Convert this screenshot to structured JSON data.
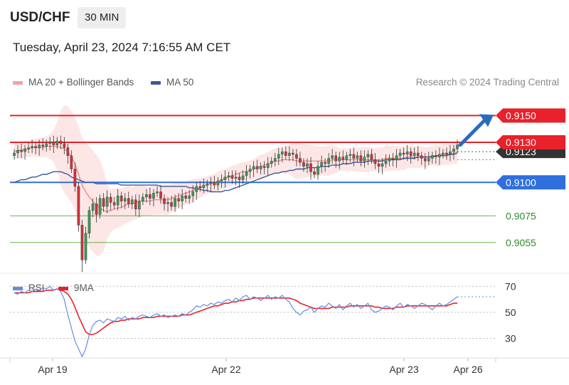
{
  "header": {
    "pair": "USD/CHF",
    "timeframe": "30 MIN"
  },
  "timestamp": "Tuesday, April 23, 2024 7:16:55 AM CET",
  "legend": {
    "ma20_bb": "MA 20 + Bollinger Bands",
    "ma50": "MA 50"
  },
  "copyright": "Research © 2024 Trading Central",
  "rsi_legend": {
    "rsi": "RSI",
    "ma9": "9MA"
  },
  "colors": {
    "resistance": "#e8212a",
    "pivot": "#2f6fde",
    "support": "#6ab04c",
    "bb_fill": "#fde2e2",
    "ma20": "#f08a8a",
    "ma50": "#3b5998",
    "bull": "#3a9a57",
    "bear": "#d2323a",
    "rsi": "#5f8fe0",
    "rsi_ma": "#e8212a",
    "arrow": "#2b6bbf"
  },
  "chart_data": [
    {
      "type": "candlestick",
      "title": "USD/CHF 30 MIN",
      "ylim": [
        0.9032,
        0.9163
      ],
      "x_ticks": [
        "Apr 19",
        "Apr 22",
        "Apr 23",
        "Apr 26"
      ],
      "levels": [
        {
          "value": 0.915,
          "label": "0.9150",
          "kind": "resistance"
        },
        {
          "value": 0.913,
          "label": "0.9130",
          "kind": "resistance"
        },
        {
          "value": 0.91,
          "label": "0.9100",
          "kind": "pivot"
        },
        {
          "value": 0.9075,
          "label": "0.9075",
          "kind": "support"
        },
        {
          "value": 0.9055,
          "label": "0.9055",
          "kind": "support"
        }
      ],
      "current_price": {
        "value": 0.9123,
        "label": "0.9123"
      },
      "projection": {
        "from": 0.9128,
        "to": 0.915,
        "direction": "up"
      },
      "closes": [
        0.9122,
        0.9124,
        0.9123,
        0.9125,
        0.9126,
        0.9127,
        0.9126,
        0.9128,
        0.9127,
        0.9129,
        0.913,
        0.9128,
        0.9131,
        0.9129,
        0.9126,
        0.912,
        0.911,
        0.9097,
        0.9068,
        0.9042,
        0.9062,
        0.9079,
        0.9084,
        0.9076,
        0.9088,
        0.9082,
        0.9089,
        0.9085,
        0.9083,
        0.909,
        0.9086,
        0.9088,
        0.9084,
        0.9087,
        0.908,
        0.9086,
        0.9089,
        0.9091,
        0.9088,
        0.9092,
        0.9093,
        0.9088,
        0.9084,
        0.9085,
        0.9082,
        0.9088,
        0.9086,
        0.909,
        0.9088,
        0.909,
        0.9093,
        0.9097,
        0.9096,
        0.9098,
        0.9099,
        0.91,
        0.9098,
        0.9101,
        0.9102,
        0.9104,
        0.9105,
        0.9103,
        0.9104,
        0.9102,
        0.9105,
        0.9108,
        0.911,
        0.9112,
        0.911,
        0.9112,
        0.9111,
        0.9114,
        0.9116,
        0.9118,
        0.9121,
        0.9123,
        0.912,
        0.9122,
        0.9121,
        0.9118,
        0.9115,
        0.9112,
        0.9114,
        0.9108,
        0.9106,
        0.9112,
        0.9115,
        0.9114,
        0.9118,
        0.912,
        0.9116,
        0.9119,
        0.9117,
        0.912,
        0.9121,
        0.9118,
        0.912,
        0.9116,
        0.9119,
        0.9121,
        0.9117,
        0.9114,
        0.9112,
        0.9114,
        0.9116,
        0.9118,
        0.9117,
        0.912,
        0.9122,
        0.9121,
        0.9123,
        0.912,
        0.9122,
        0.912,
        0.9118,
        0.9116,
        0.9118,
        0.912,
        0.9119,
        0.9121,
        0.9122,
        0.9121,
        0.9123,
        0.9125,
        0.9128
      ],
      "ma20": [
        0.9123,
        0.9124,
        0.9124,
        0.9125,
        0.9125,
        0.9126,
        0.9126,
        0.9126,
        0.9126,
        0.9127,
        0.9127,
        0.9127,
        0.9127,
        0.9126,
        0.9125,
        0.9123,
        0.9119,
        0.9114,
        0.9106,
        0.9098,
        0.9093,
        0.9089,
        0.9086,
        0.9083,
        0.9081,
        0.9079,
        0.9078,
        0.9079,
        0.908,
        0.9081,
        0.9081,
        0.9083,
        0.9084,
        0.9084,
        0.9085,
        0.9086,
        0.9086,
        0.9086,
        0.9086,
        0.9087,
        0.9087,
        0.9087,
        0.9087,
        0.9087,
        0.9088,
        0.9089,
        0.909,
        0.9091,
        0.9092,
        0.9093,
        0.9094,
        0.9095,
        0.9096,
        0.9097,
        0.9098,
        0.9099,
        0.91,
        0.9101,
        0.9102,
        0.9103,
        0.9104,
        0.9105,
        0.9106,
        0.9107,
        0.9108,
        0.9108,
        0.9109,
        0.911,
        0.9111,
        0.9112,
        0.9113,
        0.9114,
        0.9115,
        0.9116,
        0.9116,
        0.9117,
        0.9117,
        0.9117,
        0.9117,
        0.9116,
        0.9116,
        0.9116,
        0.9116,
        0.9116,
        0.9116,
        0.9116,
        0.9116,
        0.9116,
        0.9116,
        0.9117,
        0.9117,
        0.9117,
        0.9117,
        0.9117,
        0.9117,
        0.9117,
        0.9117,
        0.9117,
        0.9117,
        0.9117,
        0.9117,
        0.9117,
        0.9117,
        0.9117,
        0.9118,
        0.9118,
        0.9118,
        0.9118,
        0.9118,
        0.9118,
        0.9119,
        0.9119,
        0.9119,
        0.9119,
        0.9119,
        0.9119,
        0.9119,
        0.912,
        0.912,
        0.912,
        0.9121,
        0.9121,
        0.9121,
        0.9122,
        0.9122
      ],
      "ma50": [
        0.91,
        0.9101,
        0.9102,
        0.9102,
        0.9103,
        0.9104,
        0.9104,
        0.9105,
        0.9106,
        0.9106,
        0.9107,
        0.9108,
        0.9108,
        0.9108,
        0.9107,
        0.9106,
        0.9104,
        0.9103,
        0.9102,
        0.9101,
        0.91,
        0.91,
        0.91,
        0.9099,
        0.9099,
        0.9099,
        0.9099,
        0.9099,
        0.9099,
        0.9099,
        0.9098,
        0.9098,
        0.9098,
        0.9098,
        0.9098,
        0.9098,
        0.9098,
        0.9098,
        0.9098,
        0.9098,
        0.9098,
        0.9097,
        0.9097,
        0.9097,
        0.9097,
        0.9097,
        0.9097,
        0.9097,
        0.9097,
        0.9096,
        0.9096,
        0.9095,
        0.9095,
        0.9094,
        0.9094,
        0.9093,
        0.9093,
        0.9093,
        0.9093,
        0.9094,
        0.9094,
        0.9095,
        0.9096,
        0.9097,
        0.9098,
        0.9099,
        0.91,
        0.9101,
        0.9102,
        0.9103,
        0.9104,
        0.9105,
        0.9106,
        0.9107,
        0.9107,
        0.9108,
        0.9108,
        0.9109,
        0.9109,
        0.911,
        0.911,
        0.911,
        0.9111,
        0.9111,
        0.9111,
        0.9111,
        0.9112,
        0.9112,
        0.9112,
        0.9113,
        0.9113,
        0.9113,
        0.9114,
        0.9114,
        0.9114,
        0.9115,
        0.9115,
        0.9115,
        0.9115,
        0.9116,
        0.9116,
        0.9116,
        0.9116,
        0.9116,
        0.9117,
        0.9117,
        0.9117,
        0.9117,
        0.9117,
        0.9118,
        0.9118,
        0.9118,
        0.9118,
        0.9119,
        0.9119,
        0.9119,
        0.9119,
        0.9119,
        0.912,
        0.912,
        0.912,
        0.912,
        0.9121,
        0.9121,
        0.9122
      ]
    },
    {
      "type": "line",
      "title": "RSI",
      "ylim": [
        15,
        80
      ],
      "y_ticks": [
        70,
        50,
        30
      ],
      "series": [
        {
          "name": "RSI",
          "values": [
            65,
            64,
            66,
            65,
            67,
            66,
            68,
            67,
            69,
            68,
            70,
            67,
            68,
            66,
            60,
            48,
            38,
            28,
            22,
            16,
            22,
            33,
            40,
            43,
            44,
            42,
            45,
            44,
            43,
            46,
            45,
            47,
            44,
            46,
            45,
            47,
            48,
            47,
            46,
            48,
            49,
            47,
            48,
            46,
            47,
            48,
            47,
            49,
            48,
            50,
            52,
            55,
            54,
            56,
            55,
            57,
            56,
            58,
            57,
            59,
            60,
            58,
            61,
            59,
            62,
            63,
            60,
            62,
            61,
            59,
            61,
            63,
            60,
            62,
            61,
            63,
            60,
            58,
            53,
            50,
            48,
            51,
            52,
            54,
            50,
            53,
            55,
            54,
            57,
            55,
            53,
            56,
            52,
            55,
            57,
            54,
            56,
            53,
            55,
            57,
            52,
            50,
            51,
            53,
            55,
            54,
            52,
            55,
            57,
            54,
            56,
            55,
            53,
            55,
            57,
            56,
            54,
            52,
            55,
            57,
            55,
            56,
            58,
            60,
            62
          ]
        },
        {
          "name": "9MA",
          "values": [
            65,
            65,
            65,
            65,
            65,
            66,
            66,
            66,
            66,
            67,
            67,
            67,
            68,
            67,
            66,
            64,
            60,
            54,
            47,
            41,
            35,
            33,
            33,
            34,
            36,
            38,
            40,
            42,
            43,
            43,
            44,
            44,
            45,
            45,
            45,
            45,
            46,
            46,
            46,
            46,
            47,
            47,
            47,
            47,
            47,
            47,
            47,
            48,
            48,
            48,
            49,
            50,
            51,
            52,
            53,
            54,
            55,
            55,
            56,
            57,
            57,
            58,
            58,
            59,
            59,
            60,
            60,
            61,
            61,
            61,
            61,
            61,
            61,
            61,
            61,
            61,
            61,
            61,
            60,
            59,
            57,
            56,
            55,
            54,
            53,
            53,
            53,
            53,
            53,
            54,
            54,
            54,
            54,
            54,
            55,
            55,
            55,
            55,
            55,
            55,
            55,
            54,
            54,
            53,
            53,
            53,
            53,
            54,
            54,
            54,
            55,
            55,
            55,
            55,
            55,
            55,
            55,
            55,
            55,
            55,
            55,
            55,
            56,
            57,
            57
          ]
        }
      ]
    }
  ]
}
